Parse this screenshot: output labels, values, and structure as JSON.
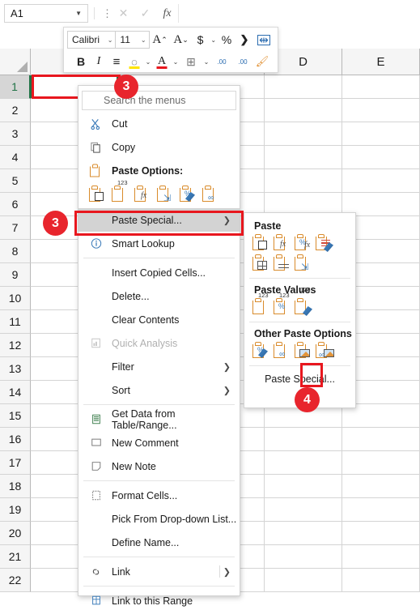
{
  "formula_bar": {
    "name_box_value": "A1",
    "name_box_caret": "▼",
    "dots": "⋮",
    "cancel_icon": "✕",
    "confirm_icon": "✓",
    "fx_label": "fx",
    "formula_value": ""
  },
  "mini_toolbar": {
    "font_name": "Calibri",
    "font_size": "11",
    "caret": "⌄",
    "grow_font": "A",
    "shrink_font": "A",
    "grow_sup": "⌃",
    "shrink_sup": "⌄",
    "accounting": "$",
    "percent": "%",
    "comma": "❯",
    "wrap_text": "⇹",
    "bold": "B",
    "italic": "I",
    "align": "≡",
    "fill_color": "◌",
    "font_color": "A",
    "borders": "⊞",
    "decrease_decimal": ".00",
    "increase_decimal": ".00",
    "format_painter": "🖌",
    "highlight_hex": "#ffe400",
    "fontcolor_hex": "#e8171e"
  },
  "grid": {
    "columns": [
      "D",
      "E"
    ],
    "rows": [
      "1",
      "2",
      "3",
      "4",
      "5",
      "6",
      "7",
      "8",
      "9",
      "10",
      "11",
      "12",
      "13",
      "14",
      "15",
      "16",
      "17",
      "18",
      "19",
      "20",
      "21",
      "22"
    ],
    "active_row": "1"
  },
  "context_menu": {
    "search_placeholder": "Search the menus",
    "items": [
      {
        "label": "Cut",
        "icon": "scissors-icon",
        "type": "item"
      },
      {
        "label": "Copy",
        "icon": "copy-icon",
        "type": "item"
      },
      {
        "label": "Paste Options:",
        "icon": "paste-icon",
        "type": "header"
      }
    ],
    "paste_options_icons": [
      "paste-all-icon",
      "paste-values-icon",
      "paste-formulas-icon",
      "paste-transpose-icon",
      "paste-formatting-icon",
      "paste-link-icon"
    ],
    "paste_special_label": "Paste Special...",
    "paste_special_arrow": "❯",
    "lower_items": [
      {
        "label": "Smart Lookup",
        "icon": "info-icon",
        "disabled": false,
        "arrow": false
      },
      {
        "label": "Insert Copied Cells...",
        "icon": "",
        "disabled": false,
        "arrow": false
      },
      {
        "label": "Delete...",
        "icon": "",
        "disabled": false,
        "arrow": false
      },
      {
        "label": "Clear Contents",
        "icon": "",
        "disabled": false,
        "arrow": false
      },
      {
        "label": "Quick Analysis",
        "icon": "quick-analysis-icon",
        "disabled": true,
        "arrow": false
      },
      {
        "label": "Filter",
        "icon": "",
        "disabled": false,
        "arrow": true
      },
      {
        "label": "Sort",
        "icon": "",
        "disabled": false,
        "arrow": true
      },
      {
        "label": "Get Data from Table/Range...",
        "icon": "get-data-icon",
        "disabled": false,
        "arrow": false
      },
      {
        "label": "New Comment",
        "icon": "comment-icon",
        "disabled": false,
        "arrow": false
      },
      {
        "label": "New Note",
        "icon": "note-icon",
        "disabled": false,
        "arrow": false
      },
      {
        "label": "Format Cells...",
        "icon": "format-cells-icon",
        "disabled": false,
        "arrow": false
      },
      {
        "label": "Pick From Drop-down List...",
        "icon": "",
        "disabled": false,
        "arrow": false
      },
      {
        "label": "Define Name...",
        "icon": "",
        "disabled": false,
        "arrow": false
      },
      {
        "label": "Link",
        "icon": "link-icon",
        "disabled": false,
        "arrow": true
      },
      {
        "label": "Link to this Range",
        "icon": "link-range-icon",
        "disabled": false,
        "arrow": false
      }
    ]
  },
  "submenu": {
    "section_paste": "Paste",
    "paste_icons_row1": [
      "paste-all-icon",
      "paste-formulas-icon",
      "paste-formulas-numfmt-icon",
      "paste-keep-source-formatting-icon"
    ],
    "paste_icons_row2": [
      "paste-no-borders-icon",
      "paste-keep-col-widths-icon",
      "paste-transpose-icon"
    ],
    "section_values": "Paste Values",
    "values_icons": [
      "paste-values-icon",
      "paste-values-numfmt-icon",
      "paste-values-srcfmt-icon"
    ],
    "section_other": "Other Paste Options",
    "other_icons": [
      "paste-formatting-icon",
      "paste-link-icon",
      "paste-picture-icon",
      "paste-linked-picture-icon"
    ],
    "footer_label": "Paste Special..."
  },
  "annotations": {
    "badge_3_top": "3",
    "badge_3_menu": "3",
    "badge_4": "4",
    "highlight_color": "#e8171e",
    "badge_color": "#e8252d"
  }
}
